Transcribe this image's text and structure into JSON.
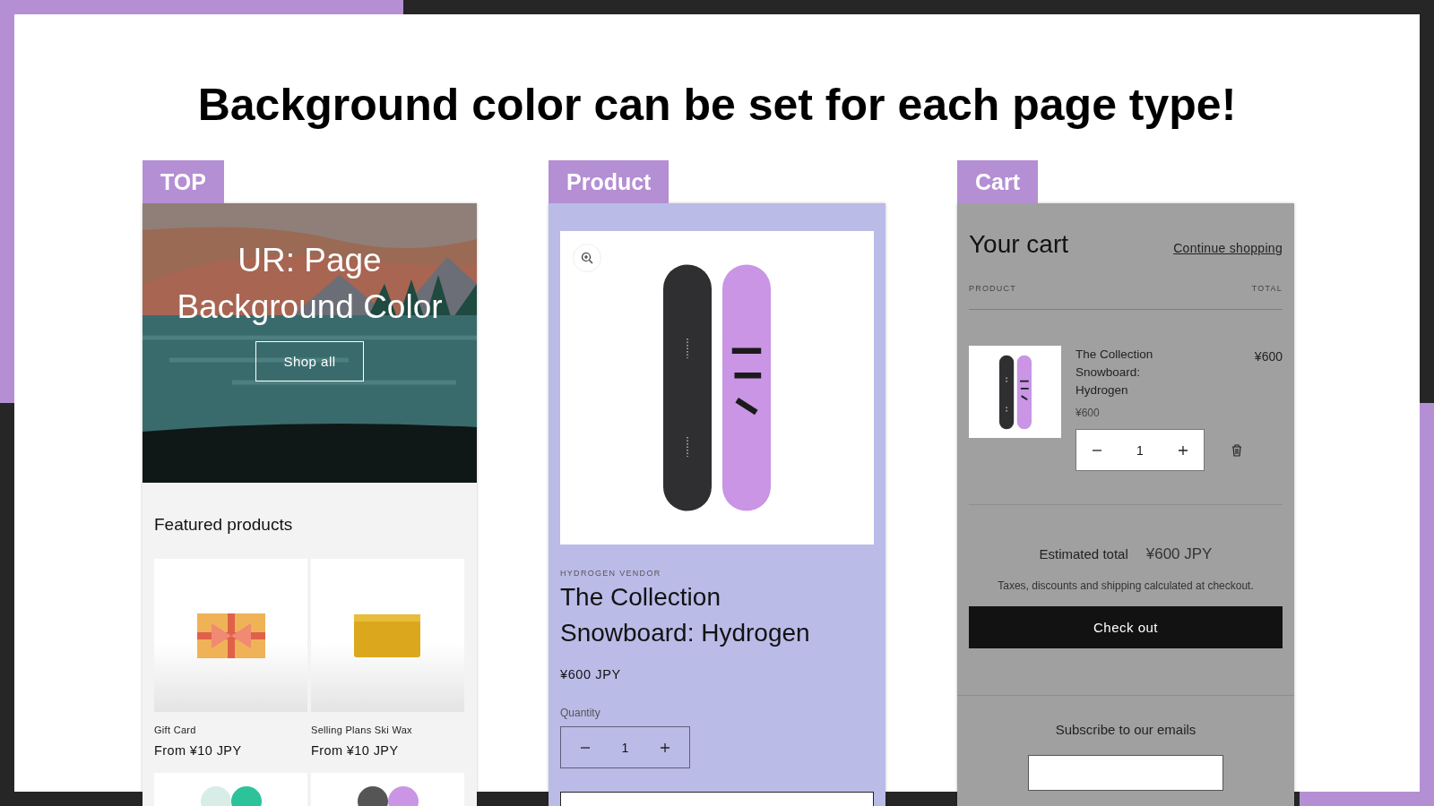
{
  "heading": "Background color can be set for each page type!",
  "panels": [
    {
      "kind": "top",
      "tab": "TOP",
      "color": "#f3f3f3",
      "hero": {
        "title": "UR: Page Background Color",
        "button": "Shop all"
      },
      "section_title": "Featured products",
      "products": [
        {
          "name": "Gift Card",
          "price": "From ¥10 JPY"
        },
        {
          "name": "Selling Plans Ski Wax",
          "price": "From ¥10 JPY"
        }
      ]
    },
    {
      "kind": "product",
      "tab": "Product",
      "color": "#bbbbe8",
      "vendor": "HYDROGEN VENDOR",
      "title": "The Collection Snowboard: Hydrogen",
      "price": "¥600 JPY",
      "quantity_label": "Quantity",
      "quantity": "1"
    },
    {
      "kind": "cart",
      "tab": "Cart",
      "color": "#a0a0a0",
      "title": "Your cart",
      "continue_link": "Continue shopping",
      "columns": [
        "PRODUCT",
        "TOTAL"
      ],
      "item": {
        "name": "The Collection Snowboard: Hydrogen",
        "unit_price": "¥600",
        "quantity": "1",
        "total": "¥600"
      },
      "estimated_label": "Estimated total",
      "estimated_value": "¥600 JPY",
      "note": "Taxes, discounts and shipping calculated at checkout.",
      "checkout": "Check out",
      "subscribe": "Subscribe to our emails"
    }
  ]
}
